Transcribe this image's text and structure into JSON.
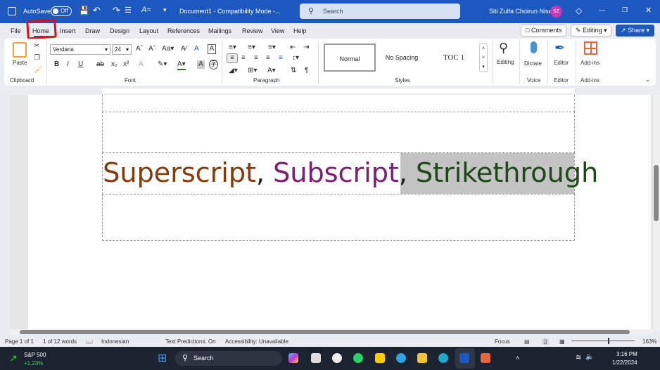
{
  "titlebar": {
    "autosave_label": "AutoSave",
    "autosave_state": "Off",
    "doc_title": "Document1  -  Compatibility Mode  -...",
    "search_placeholder": "Search",
    "user_name": "Siti Zulfa Choirun Nisa",
    "user_initials": "SZ"
  },
  "tabs": [
    "File",
    "Home",
    "Insert",
    "Draw",
    "Design",
    "Layout",
    "References",
    "Mailings",
    "Review",
    "View",
    "Help"
  ],
  "active_tab": "Home",
  "actions": {
    "comments": "Comments",
    "editing": "Editing",
    "share": "Share"
  },
  "ribbon": {
    "clipboard": {
      "label": "Clipboard",
      "paste": "Paste"
    },
    "font": {
      "label": "Font",
      "font_name": "Verdana",
      "font_size": "24"
    },
    "paragraph": {
      "label": "Paragraph"
    },
    "styles": {
      "label": "Styles",
      "items": [
        "Normal",
        "No Spacing",
        "TOC 1"
      ]
    },
    "editing": {
      "label": "Editing"
    },
    "voice": {
      "label": "Voice",
      "dictate": "Dictate"
    },
    "editor": {
      "label": "Editor",
      "button": "Editor"
    },
    "addins": {
      "label": "Add-ins",
      "button": "Add-ins"
    }
  },
  "document": {
    "word1": "Superscript",
    "sep1": ", ",
    "word2": "Subscript",
    "sep2": ", ",
    "word3": "Strikethrough",
    "colors": {
      "word1": "#843c0c",
      "word2": "#7b2172",
      "word3": "#1e4a17",
      "highlight": "#c4c4c4"
    }
  },
  "statusbar": {
    "page": "Page 1 of 1",
    "words": "1 of 12 words",
    "language": "Indonesian",
    "predictions": "Text Predictions: On",
    "accessibility": "Accessibility: Unavailable",
    "focus": "Focus",
    "zoom": "163%"
  },
  "taskbar": {
    "stock_name": "S&P 500",
    "stock_change": "+1,23%",
    "search": "Search",
    "time": "3:16 PM",
    "date": "1/22/2024"
  }
}
